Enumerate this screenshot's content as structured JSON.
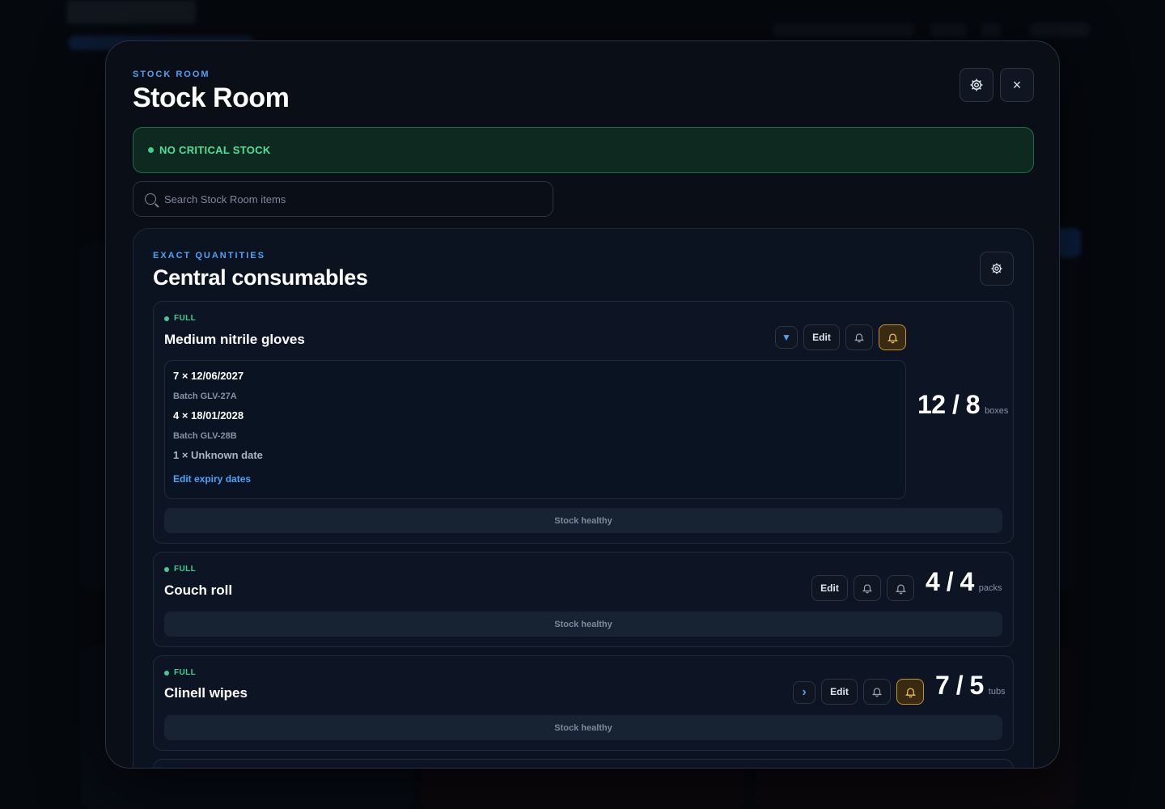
{
  "modal": {
    "eyebrow": "STOCK ROOM",
    "title": "Stock Room",
    "settings_icon": "gear-icon",
    "close_icon": "close-icon",
    "close_glyph": "×",
    "alert": {
      "text": "NO CRITICAL STOCK",
      "color": "#3ecf8e"
    },
    "search": {
      "placeholder": "Search Stock Room items",
      "value": ""
    }
  },
  "section": {
    "eyebrow": "EXACT QUANTITIES",
    "title": "Central consumables",
    "items": [
      {
        "status": "FULL",
        "name": "Medium nitrile gloves",
        "toggle_glyph": "▼",
        "edit_label": "Edit",
        "qty": "12 / 8",
        "unit": "boxes",
        "expiry": [
          {
            "line": "7 × 12/06/2027",
            "batch": "Batch GLV-27A"
          },
          {
            "line": "4 × 18/01/2028",
            "batch": "Batch GLV-28B"
          },
          {
            "line": "1 × Unknown date",
            "batch": ""
          }
        ],
        "expiry_link": "Edit expiry dates",
        "health": "Stock healthy",
        "alert_active": true
      },
      {
        "status": "FULL",
        "name": "Couch roll",
        "edit_label": "Edit",
        "qty": "4 / 4",
        "unit": "packs",
        "health": "Stock healthy",
        "alert_active": false
      },
      {
        "status": "FULL",
        "name": "Clinell wipes",
        "toggle_glyph": "›",
        "edit_label": "Edit",
        "qty": "7 / 5",
        "unit": "tubs",
        "health": "Stock healthy",
        "alert_active": true
      }
    ]
  },
  "colors": {
    "accent": "#4fa3f7",
    "success": "#3ecf8e",
    "warning": "#c8922f"
  }
}
